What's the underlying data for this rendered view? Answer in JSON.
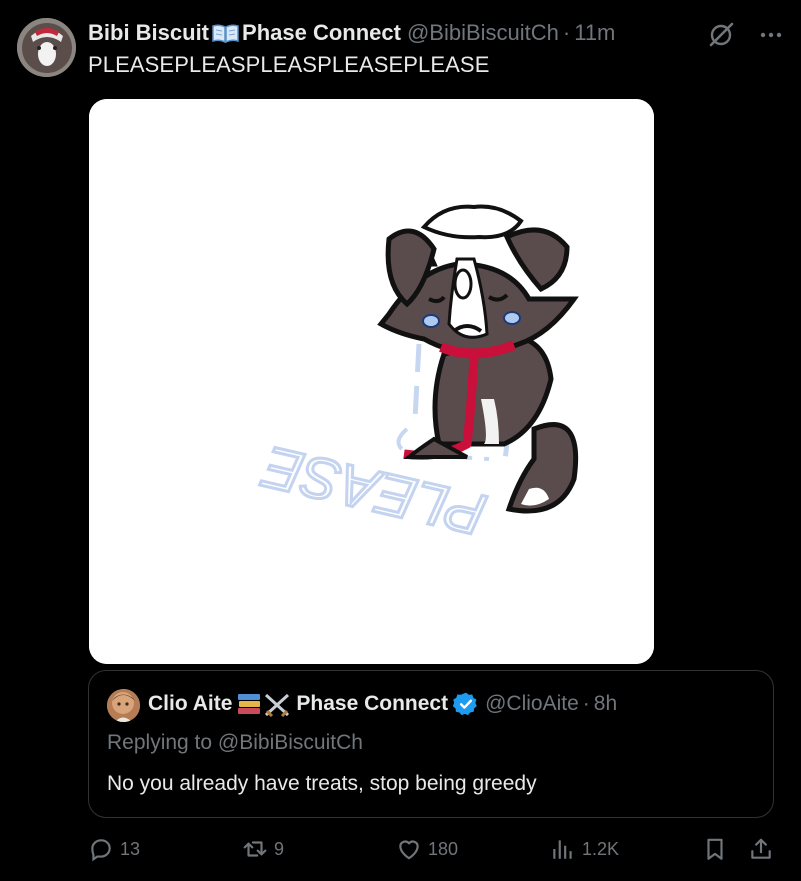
{
  "tweet": {
    "author_name": "Bibi Biscuit",
    "author_name_suffix": "Phase Connect",
    "author_handle": "@BibiBiscuitCh",
    "separator": "·",
    "time": "11m",
    "text": "PLEASEPLEASPLEASPLEASEPLEASE",
    "media_text": "PLEASE",
    "icons": [
      "grok-icon",
      "more-icon"
    ]
  },
  "quote": {
    "author_name": "Clio Aite",
    "author_name_suffix": "Phase Connect",
    "author_handle": "@ClioAite",
    "separator": "·",
    "time": "8h",
    "replying_to": "Replying to @BibiBiscuitCh",
    "text": "No you already have treats, stop being greedy"
  },
  "actions": {
    "replies": "13",
    "reposts": "9",
    "likes": "180",
    "views": "1.2K"
  },
  "colors": {
    "background": "#000000",
    "text": "#e7e9ea",
    "muted": "#71767b",
    "border": "#2f3336",
    "verified": "#1d9bf0"
  }
}
